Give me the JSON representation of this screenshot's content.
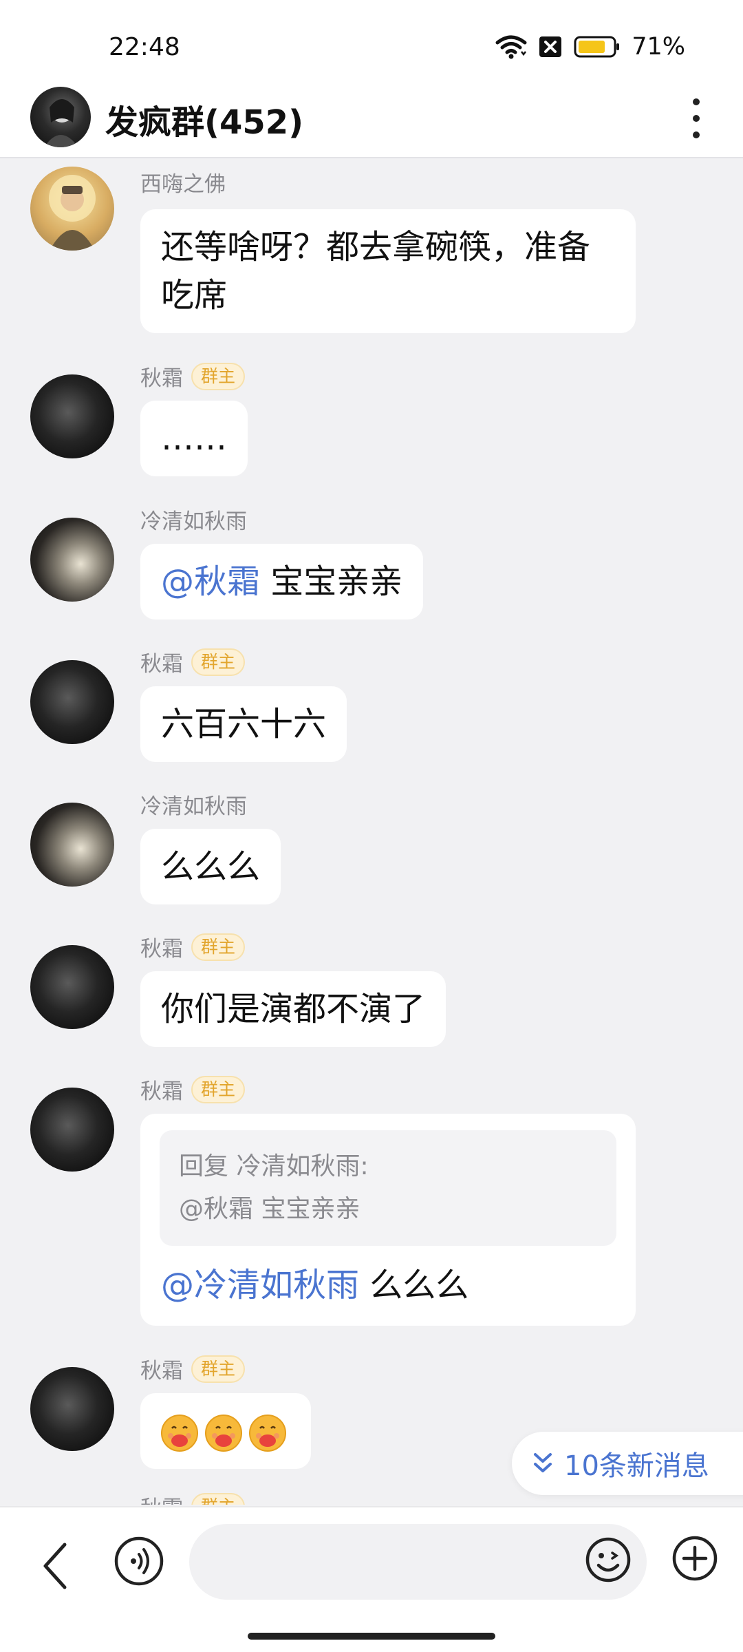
{
  "status_bar": {
    "time": "22:48",
    "battery": "71%"
  },
  "header": {
    "title": "发疯群(452)"
  },
  "messages": [
    {
      "sender": "西嗨之佛",
      "text": "还等啥呀？都去拿碗筷，准备吃席"
    },
    {
      "sender": "秋霜",
      "badge": "群主",
      "text": "……"
    },
    {
      "sender": "冷清如秋雨",
      "mention": "@秋霜",
      "text": " 宝宝亲亲"
    },
    {
      "sender": "秋霜",
      "badge": "群主",
      "text": "六百六十六"
    },
    {
      "sender": "冷清如秋雨",
      "text": "么么么"
    },
    {
      "sender": "秋霜",
      "badge": "群主",
      "text": "你们是演都不演了"
    },
    {
      "sender": "秋霜",
      "badge": "群主",
      "quote": {
        "line1": "回复 冷清如秋雨:",
        "line2": "@秋霜 宝宝亲亲"
      },
      "mention": "@冷清如秋雨",
      "text": " 么么么"
    },
    {
      "sender": "秋霜",
      "badge": "群主"
    },
    {
      "sender": "秋霜",
      "badge": "群主"
    }
  ],
  "new_messages": "10条新消息",
  "icons": {
    "wifi": "wifi-icon",
    "sim": "no-sim-icon",
    "battery": "battery-icon",
    "more": "more-vertical-icon",
    "back": "chevron-left-icon",
    "voice": "voice-icon",
    "emoji": "smiley-icon",
    "plus": "plus-icon",
    "expand": "double-chevron-down-icon",
    "hug_emoji": "hug-emoji"
  },
  "colors": {
    "mention": "#4a74d0",
    "badge_text": "#e2a52d",
    "badge_bg": "#fdf1d6",
    "battery_fill": "#f5c518"
  }
}
